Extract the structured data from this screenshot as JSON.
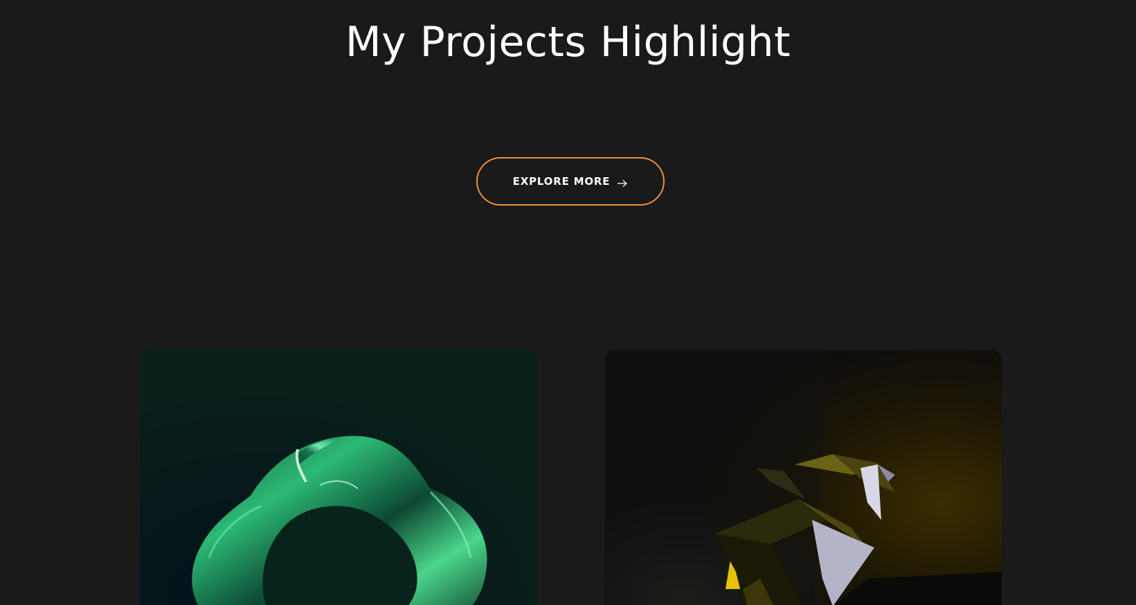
{
  "section": {
    "title": "My Projects Highlight"
  },
  "explore_button": {
    "label": "EXPLORE MORE",
    "icon": "arrow-right-icon"
  },
  "colors": {
    "background": "#1a1a1a",
    "accent": "#f0913f",
    "text": "#ffffff"
  },
  "projects": [
    {
      "image": "green-glass-ribbon-3d-render"
    },
    {
      "image": "gold-silver-origami-bird-3d-render"
    }
  ]
}
